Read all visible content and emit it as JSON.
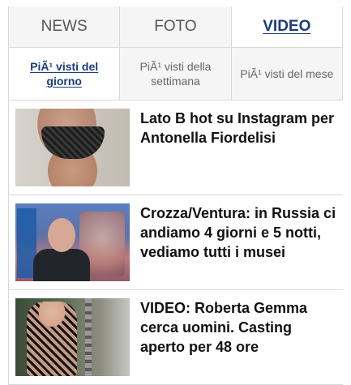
{
  "tabs": [
    {
      "label": "NEWS",
      "active": false
    },
    {
      "label": "FOTO",
      "active": false
    },
    {
      "label": "VIDEO",
      "active": true
    }
  ],
  "subtabs": [
    {
      "label": "PiÃ¹ visti del giorno",
      "active": true
    },
    {
      "label": "PiÃ¹ visti della settimana",
      "active": false
    },
    {
      "label": "PiÃ¹ visti del mese",
      "active": false
    }
  ],
  "items": [
    {
      "title": "Lato B hot su Instagram per Antonella Fiordelisi",
      "thumb_icon": "photo-thumbnail"
    },
    {
      "title": "Crozza/Ventura: in Russia ci andiamo 4 giorni e 5 notti, vediamo tutti i musei",
      "thumb_icon": "photo-thumbnail"
    },
    {
      "title": "VIDEO: Roberta Gemma cerca uomini. Casting aperto per 48 ore",
      "thumb_icon": "photo-thumbnail"
    }
  ],
  "colors": {
    "accent": "#1a3d7c",
    "border": "#d9d9d9",
    "tab_bg": "#f5f5f5"
  }
}
